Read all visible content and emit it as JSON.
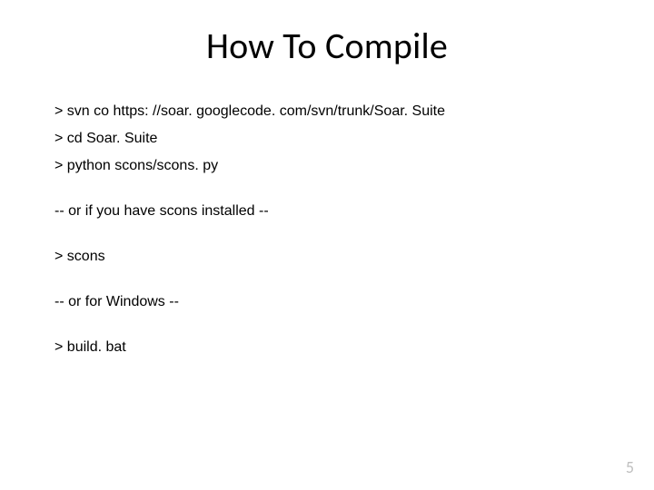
{
  "title": "How To Compile",
  "lines": [
    "> svn co https: //soar. googlecode. com/svn/trunk/Soar. Suite",
    "> cd Soar. Suite",
    "> python scons/scons. py"
  ],
  "note1": "-- or if you have scons installed --",
  "line_scons": "> scons",
  "note2": "-- or for Windows --",
  "line_build": "> build. bat",
  "page_number": "5"
}
